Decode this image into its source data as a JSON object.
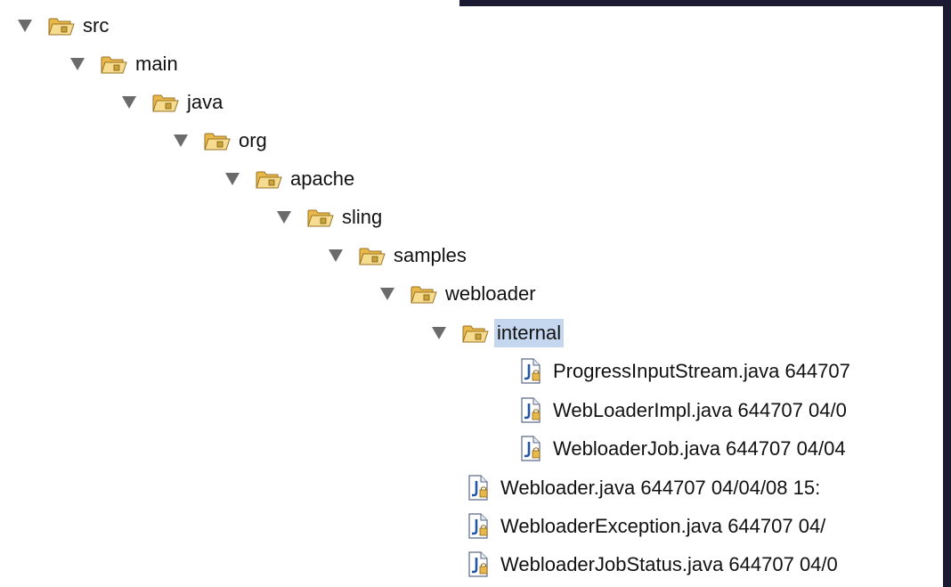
{
  "tree": {
    "folders": [
      {
        "label": "src",
        "expanded": true
      },
      {
        "label": "main",
        "expanded": true
      },
      {
        "label": "java",
        "expanded": true
      },
      {
        "label": "org",
        "expanded": true
      },
      {
        "label": "apache",
        "expanded": true
      },
      {
        "label": "sling",
        "expanded": true
      },
      {
        "label": "samples",
        "expanded": true
      },
      {
        "label": "webloader",
        "expanded": true
      },
      {
        "label": "internal",
        "expanded": true,
        "selected": true
      }
    ],
    "internal_files": [
      {
        "label": "ProgressInputStream.java 644707"
      },
      {
        "label": "WebLoaderImpl.java 644707  04/0"
      },
      {
        "label": "WebloaderJob.java 644707  04/04"
      }
    ],
    "webloader_files": [
      {
        "label": "Webloader.java 644707  04/04/08 15:"
      },
      {
        "label": "WebloaderException.java 644707  04/"
      },
      {
        "label": "WebloaderJobStatus.java 644707  04/0"
      }
    ]
  },
  "colors": {
    "selection": "#c5d6ef",
    "folder": "#e8b84a",
    "dark_background": "#1a1a32"
  }
}
